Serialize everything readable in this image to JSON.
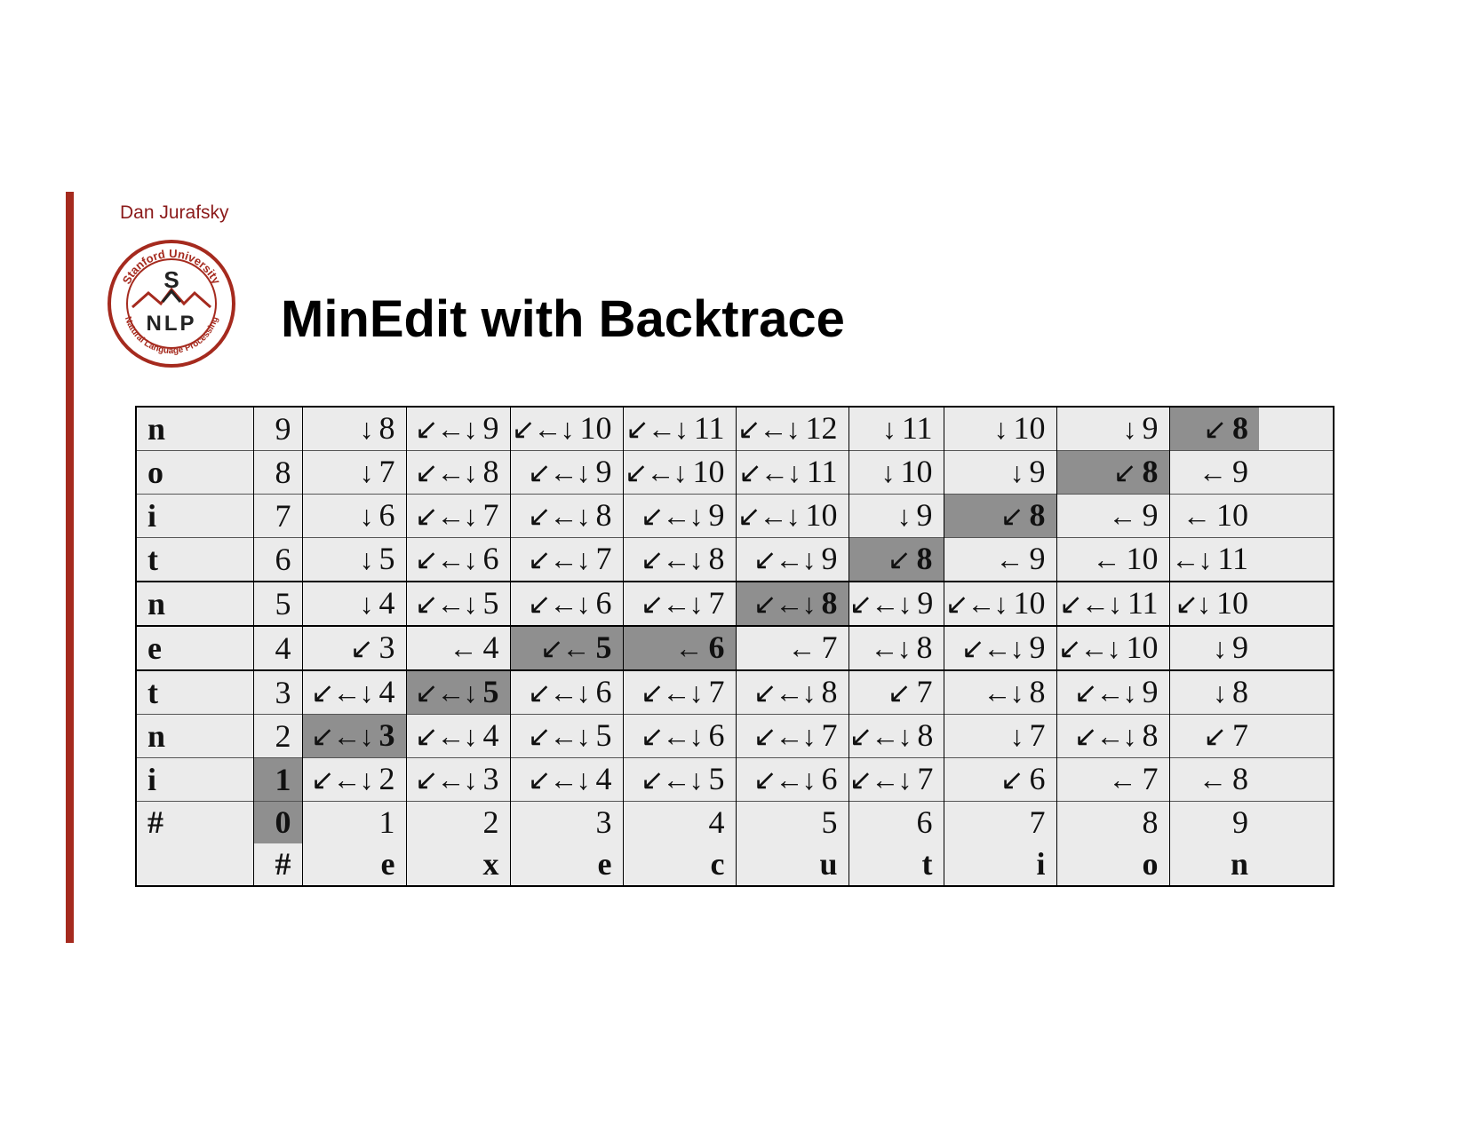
{
  "header": {
    "author": "Dan Jurafsky",
    "title": "MinEdit with Backtrace"
  },
  "logo": {
    "top_text": "Stanford University",
    "bottom_text": "Natural Language Processing",
    "letters_top": "S",
    "letters_bottom": "NLP",
    "color": "#a52a1e"
  },
  "colors": {
    "accent": "#a52a1e",
    "table_bg": "#ebebeb",
    "highlight": "#8f8f8f"
  },
  "table": {
    "rows": [
      {
        "label": "n",
        "cells": [
          {
            "arrow": "",
            "value": "9",
            "hl": false
          },
          {
            "arrow": "↓",
            "value": "8",
            "hl": false
          },
          {
            "arrow": "↙←↓",
            "value": "9",
            "hl": false
          },
          {
            "arrow": "↙←↓",
            "value": "10",
            "hl": false
          },
          {
            "arrow": "↙←↓",
            "value": "11",
            "hl": false
          },
          {
            "arrow": "↙←↓",
            "value": "12",
            "hl": false
          },
          {
            "arrow": "↓",
            "value": "11",
            "hl": false
          },
          {
            "arrow": "↓",
            "value": "10",
            "hl": false
          },
          {
            "arrow": "↓",
            "value": "9",
            "hl": false
          },
          {
            "arrow": "↙",
            "value": "8",
            "hl": true
          }
        ]
      },
      {
        "label": "o",
        "cells": [
          {
            "arrow": "",
            "value": "8",
            "hl": false
          },
          {
            "arrow": "↓",
            "value": "7",
            "hl": false
          },
          {
            "arrow": "↙←↓",
            "value": "8",
            "hl": false
          },
          {
            "arrow": "↙←↓",
            "value": "9",
            "hl": false
          },
          {
            "arrow": "↙←↓",
            "value": "10",
            "hl": false
          },
          {
            "arrow": "↙←↓",
            "value": "11",
            "hl": false
          },
          {
            "arrow": "↓",
            "value": "10",
            "hl": false
          },
          {
            "arrow": "↓",
            "value": "9",
            "hl": false
          },
          {
            "arrow": "↙",
            "value": "8",
            "hl": true
          },
          {
            "arrow": "←",
            "value": "9",
            "hl": false
          }
        ]
      },
      {
        "label": "i",
        "cells": [
          {
            "arrow": "",
            "value": "7",
            "hl": false
          },
          {
            "arrow": "↓",
            "value": "6",
            "hl": false
          },
          {
            "arrow": "↙←↓",
            "value": "7",
            "hl": false
          },
          {
            "arrow": "↙←↓",
            "value": "8",
            "hl": false
          },
          {
            "arrow": "↙←↓",
            "value": "9",
            "hl": false
          },
          {
            "arrow": "↙←↓",
            "value": "10",
            "hl": false
          },
          {
            "arrow": "↓",
            "value": "9",
            "hl": false
          },
          {
            "arrow": "↙",
            "value": "8",
            "hl": true
          },
          {
            "arrow": "←",
            "value": "9",
            "hl": false
          },
          {
            "arrow": "←",
            "value": "10",
            "hl": false
          }
        ]
      },
      {
        "label": "t",
        "cells": [
          {
            "arrow": "",
            "value": "6",
            "hl": false
          },
          {
            "arrow": "↓",
            "value": "5",
            "hl": false
          },
          {
            "arrow": "↙←↓",
            "value": "6",
            "hl": false
          },
          {
            "arrow": "↙←↓",
            "value": "7",
            "hl": false
          },
          {
            "arrow": "↙←↓",
            "value": "8",
            "hl": false
          },
          {
            "arrow": "↙←↓",
            "value": "9",
            "hl": false
          },
          {
            "arrow": "↙",
            "value": "8",
            "hl": true
          },
          {
            "arrow": "←",
            "value": "9",
            "hl": false
          },
          {
            "arrow": "←",
            "value": "10",
            "hl": false
          },
          {
            "arrow": "←↓",
            "value": "11",
            "hl": false
          }
        ]
      },
      {
        "label": "n",
        "cells": [
          {
            "arrow": "",
            "value": "5",
            "hl": false
          },
          {
            "arrow": "↓",
            "value": "4",
            "hl": false
          },
          {
            "arrow": "↙←↓",
            "value": "5",
            "hl": false
          },
          {
            "arrow": "↙←↓",
            "value": "6",
            "hl": false
          },
          {
            "arrow": "↙←↓",
            "value": "7",
            "hl": false
          },
          {
            "arrow": "↙←↓",
            "value": "8",
            "hl": true
          },
          {
            "arrow": "↙←↓",
            "value": "9",
            "hl": false
          },
          {
            "arrow": "↙←↓",
            "value": "10",
            "hl": false
          },
          {
            "arrow": "↙←↓",
            "value": "11",
            "hl": false
          },
          {
            "arrow": "↙↓",
            "value": "10",
            "hl": false
          }
        ]
      },
      {
        "label": "e",
        "cells": [
          {
            "arrow": "",
            "value": "4",
            "hl": false
          },
          {
            "arrow": "↙",
            "value": "3",
            "hl": false
          },
          {
            "arrow": "←",
            "value": "4",
            "hl": false
          },
          {
            "arrow": "↙←",
            "value": "5",
            "hl": true
          },
          {
            "arrow": "←",
            "value": "6",
            "hl": true
          },
          {
            "arrow": "←",
            "value": "7",
            "hl": false
          },
          {
            "arrow": "←↓",
            "value": "8",
            "hl": false
          },
          {
            "arrow": "↙←↓",
            "value": "9",
            "hl": false
          },
          {
            "arrow": "↙←↓",
            "value": "10",
            "hl": false
          },
          {
            "arrow": "↓",
            "value": "9",
            "hl": false
          }
        ]
      },
      {
        "label": "t",
        "cells": [
          {
            "arrow": "",
            "value": "3",
            "hl": false
          },
          {
            "arrow": "↙←↓",
            "value": "4",
            "hl": false
          },
          {
            "arrow": "↙←↓",
            "value": "5",
            "hl": true
          },
          {
            "arrow": "↙←↓",
            "value": "6",
            "hl": false
          },
          {
            "arrow": "↙←↓",
            "value": "7",
            "hl": false
          },
          {
            "arrow": "↙←↓",
            "value": "8",
            "hl": false
          },
          {
            "arrow": "↙",
            "value": "7",
            "hl": false
          },
          {
            "arrow": "←↓",
            "value": "8",
            "hl": false
          },
          {
            "arrow": "↙←↓",
            "value": "9",
            "hl": false
          },
          {
            "arrow": "↓",
            "value": "8",
            "hl": false
          }
        ]
      },
      {
        "label": "n",
        "cells": [
          {
            "arrow": "",
            "value": "2",
            "hl": false
          },
          {
            "arrow": "↙←↓",
            "value": "3",
            "hl": true
          },
          {
            "arrow": "↙←↓",
            "value": "4",
            "hl": false
          },
          {
            "arrow": "↙←↓",
            "value": "5",
            "hl": false
          },
          {
            "arrow": "↙←↓",
            "value": "6",
            "hl": false
          },
          {
            "arrow": "↙←↓",
            "value": "7",
            "hl": false
          },
          {
            "arrow": "↙←↓",
            "value": "8",
            "hl": false
          },
          {
            "arrow": "↓",
            "value": "7",
            "hl": false
          },
          {
            "arrow": "↙←↓",
            "value": "8",
            "hl": false
          },
          {
            "arrow": "↙",
            "value": "7",
            "hl": false
          }
        ]
      },
      {
        "label": "i",
        "cells": [
          {
            "arrow": "",
            "value": "1",
            "hl": true
          },
          {
            "arrow": "↙←↓",
            "value": "2",
            "hl": false
          },
          {
            "arrow": "↙←↓",
            "value": "3",
            "hl": false
          },
          {
            "arrow": "↙←↓",
            "value": "4",
            "hl": false
          },
          {
            "arrow": "↙←↓",
            "value": "5",
            "hl": false
          },
          {
            "arrow": "↙←↓",
            "value": "6",
            "hl": false
          },
          {
            "arrow": "↙←↓",
            "value": "7",
            "hl": false
          },
          {
            "arrow": "↙",
            "value": "6",
            "hl": false
          },
          {
            "arrow": "←",
            "value": "7",
            "hl": false
          },
          {
            "arrow": "←",
            "value": "8",
            "hl": false
          }
        ]
      },
      {
        "label": "#",
        "cells": [
          {
            "arrow": "",
            "value": "0",
            "hl": true
          },
          {
            "arrow": "",
            "value": "1",
            "hl": false
          },
          {
            "arrow": "",
            "value": "2",
            "hl": false
          },
          {
            "arrow": "",
            "value": "3",
            "hl": false
          },
          {
            "arrow": "",
            "value": "4",
            "hl": false
          },
          {
            "arrow": "",
            "value": "5",
            "hl": false
          },
          {
            "arrow": "",
            "value": "6",
            "hl": false
          },
          {
            "arrow": "",
            "value": "7",
            "hl": false
          },
          {
            "arrow": "",
            "value": "8",
            "hl": false
          },
          {
            "arrow": "",
            "value": "9",
            "hl": false
          }
        ]
      }
    ],
    "bottom_labels": [
      "#",
      "e",
      "x",
      "e",
      "c",
      "u",
      "t",
      "i",
      "o",
      "n"
    ]
  }
}
